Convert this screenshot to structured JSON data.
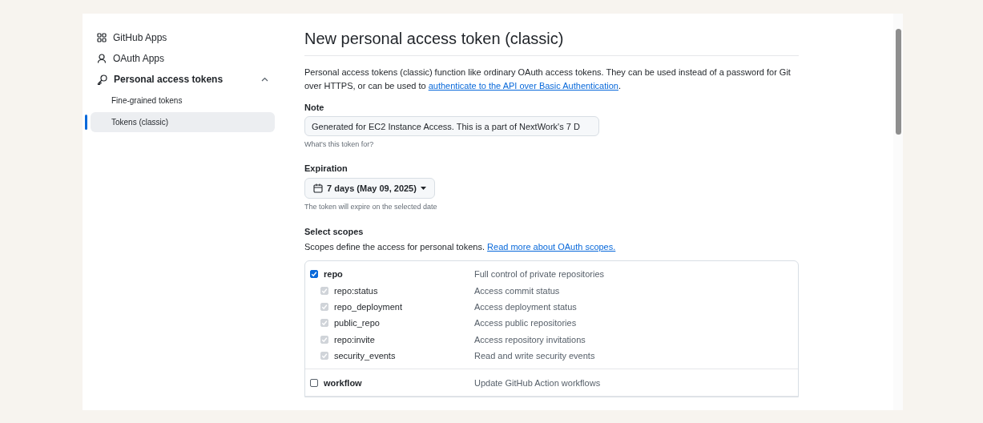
{
  "sidebar": {
    "items": [
      {
        "kind": "apps",
        "label": "GitHub Apps",
        "selected": false
      },
      {
        "kind": "person",
        "label": "OAuth Apps",
        "selected": false
      },
      {
        "kind": "key",
        "label": "Personal access tokens",
        "selected": false,
        "expanded": true,
        "children": [
          {
            "label": "Fine-grained tokens",
            "selected": false
          },
          {
            "label": "Tokens (classic)",
            "selected": true
          }
        ]
      }
    ]
  },
  "main": {
    "title": "New personal access token (classic)",
    "intro": "Personal access tokens (classic) function like ordinary OAuth access tokens. They can be used instead of a password for Git over HTTPS, or can be used to",
    "intro_link": "authenticate to the API over Basic Authentication",
    "intro_end": ".",
    "note": {
      "label": "Note",
      "value": "Generated for EC2 Instance Access. This is a part of NextWork's 7 D",
      "hint": "What's this token for?"
    },
    "expiration": {
      "label": "Expiration",
      "value": "7 days (May 09, 2025)",
      "hint": "The token will expire on the selected date"
    },
    "scopes": {
      "label": "Select scopes",
      "description": "Scopes define the access for personal tokens.",
      "link": "Read more about OAuth scopes.",
      "groups": [
        {
          "name": "repo",
          "description": "Full control of private repositories",
          "checked": true,
          "children": [
            {
              "name": "repo:status",
              "description": "Access commit status",
              "checked": true,
              "disabled": true
            },
            {
              "name": "repo_deployment",
              "description": "Access deployment status",
              "checked": true,
              "disabled": true
            },
            {
              "name": "public_repo",
              "description": "Access public repositories",
              "checked": true,
              "disabled": true
            },
            {
              "name": "repo:invite",
              "description": "Access repository invitations",
              "checked": true,
              "disabled": true
            },
            {
              "name": "security_events",
              "description": "Read and write security events",
              "checked": true,
              "disabled": true
            }
          ]
        },
        {
          "name": "workflow",
          "description": "Update GitHub Action workflows",
          "checked": false
        }
      ]
    }
  }
}
